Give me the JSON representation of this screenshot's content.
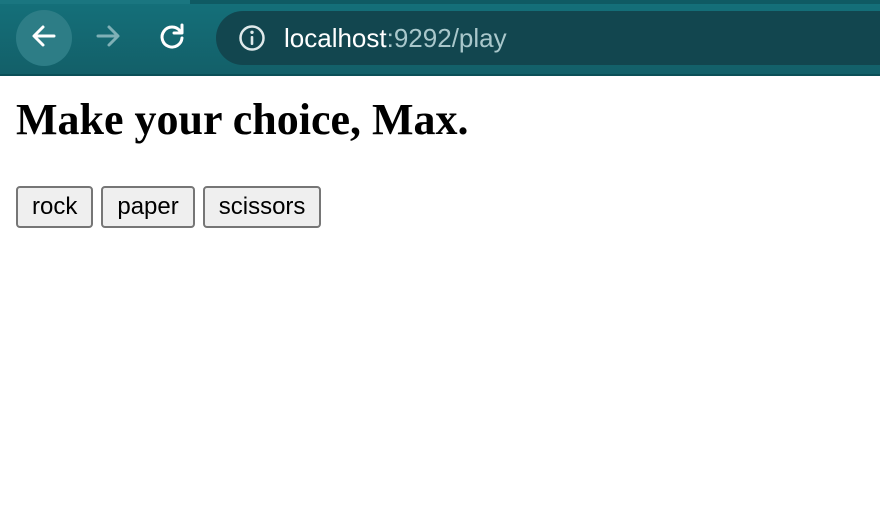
{
  "browser": {
    "url_host": "localhost",
    "url_rest": ":9292/play",
    "icons": {
      "back": "arrow-left-icon",
      "forward": "arrow-right-icon",
      "reload": "reload-icon",
      "info": "info-icon"
    },
    "colors": {
      "toolbar": "#14707a",
      "omnibox": "#12464f"
    }
  },
  "page": {
    "heading": "Make your choice, Max.",
    "choices": [
      {
        "label": "rock"
      },
      {
        "label": "paper"
      },
      {
        "label": "scissors"
      }
    ]
  }
}
